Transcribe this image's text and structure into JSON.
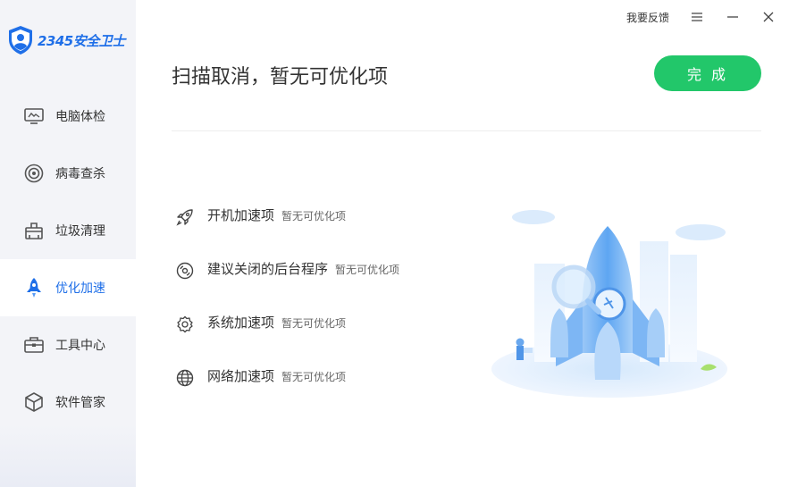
{
  "app": {
    "logo_text": "2345安全卫士"
  },
  "topbar": {
    "feedback": "我要反馈",
    "menu_icon": "menu-icon",
    "minimize_icon": "minimize-icon",
    "close_icon": "close-icon"
  },
  "sidebar": {
    "items": [
      {
        "label": "电脑体检",
        "icon": "monitor-icon"
      },
      {
        "label": "病毒查杀",
        "icon": "target-icon"
      },
      {
        "label": "垃圾清理",
        "icon": "trash-icon"
      },
      {
        "label": "优化加速",
        "icon": "rocket-icon",
        "active": true
      },
      {
        "label": "工具中心",
        "icon": "toolbox-icon"
      },
      {
        "label": "软件管家",
        "icon": "box-icon"
      }
    ]
  },
  "main": {
    "headline": "扫描取消，暂无可优化项",
    "done_label": "完 成",
    "items": [
      {
        "label": "开机加速项",
        "status": "暂无可优化项",
        "icon": "rocket-icon"
      },
      {
        "label": "建议关闭的后台程序",
        "status": "暂无可优化项",
        "icon": "disc-icon"
      },
      {
        "label": "系统加速项",
        "status": "暂无可优化项",
        "icon": "gear-icon"
      },
      {
        "label": "网络加速项",
        "status": "暂无可优化项",
        "icon": "globe-icon"
      }
    ]
  },
  "colors": {
    "accent": "#1f6fe8",
    "success": "#22c76a",
    "sidebar_bg": "#f3f4f8"
  }
}
